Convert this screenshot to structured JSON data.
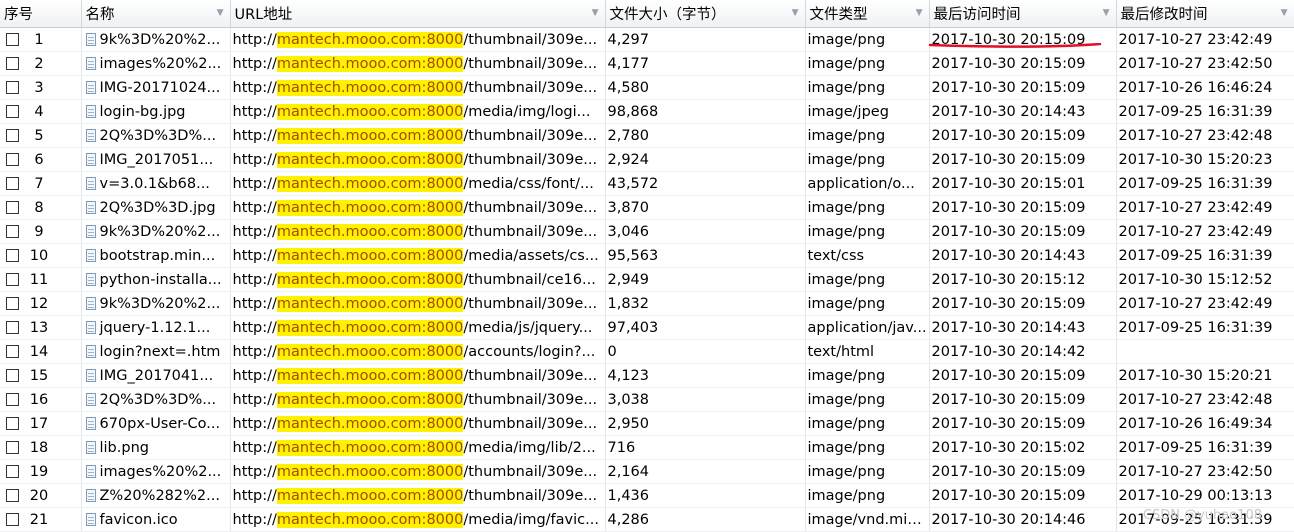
{
  "columns": [
    "序号",
    "名称",
    "URL地址",
    "文件大小（字节）",
    "文件类型",
    "最后访问时间",
    "最后修改时间"
  ],
  "host_highlight": "mantech.mooo.com:8000",
  "url_prefix": "http://",
  "rows": [
    {
      "no": "1",
      "name": "9k%3D%20%2...",
      "path": "/thumbnail/309e...",
      "size": "4,297",
      "type": "image/png",
      "accessed": "2017-10-30 20:15:09",
      "modified": "2017-10-27 23:42:49"
    },
    {
      "no": "2",
      "name": "images%20%2...",
      "path": "/thumbnail/309e...",
      "size": "4,177",
      "type": "image/png",
      "accessed": "2017-10-30 20:15:09",
      "modified": "2017-10-27 23:42:50"
    },
    {
      "no": "3",
      "name": "IMG-20171024...",
      "path": "/thumbnail/309e...",
      "size": "4,580",
      "type": "image/png",
      "accessed": "2017-10-30 20:15:09",
      "modified": "2017-10-26 16:46:24"
    },
    {
      "no": "4",
      "name": "login-bg.jpg",
      "path": "/media/img/logi...",
      "size": "98,868",
      "type": "image/jpeg",
      "accessed": "2017-10-30 20:14:43",
      "modified": "2017-09-25 16:31:39"
    },
    {
      "no": "5",
      "name": "2Q%3D%3D%...",
      "path": "/thumbnail/309e...",
      "size": "2,780",
      "type": "image/png",
      "accessed": "2017-10-30 20:15:09",
      "modified": "2017-10-27 23:42:48"
    },
    {
      "no": "6",
      "name": "IMG_2017051...",
      "path": "/thumbnail/309e...",
      "size": "2,924",
      "type": "image/png",
      "accessed": "2017-10-30 20:15:09",
      "modified": "2017-10-30 15:20:23"
    },
    {
      "no": "7",
      "name": "v=3.0.1&b68...",
      "path": "/media/css/font/...",
      "size": "43,572",
      "type": "application/o...",
      "accessed": "2017-10-30 20:15:01",
      "modified": "2017-09-25 16:31:39"
    },
    {
      "no": "8",
      "name": "2Q%3D%3D.jpg",
      "path": "/thumbnail/309e...",
      "size": "3,870",
      "type": "image/png",
      "accessed": "2017-10-30 20:15:09",
      "modified": "2017-10-27 23:42:49"
    },
    {
      "no": "9",
      "name": "9k%3D%20%2...",
      "path": "/thumbnail/309e...",
      "size": "3,046",
      "type": "image/png",
      "accessed": "2017-10-30 20:15:09",
      "modified": "2017-10-27 23:42:49"
    },
    {
      "no": "10",
      "name": "bootstrap.min...",
      "path": "/media/assets/cs...",
      "size": "95,563",
      "type": "text/css",
      "accessed": "2017-10-30 20:14:43",
      "modified": "2017-09-25 16:31:39"
    },
    {
      "no": "11",
      "name": "python-installa...",
      "path": "/thumbnail/ce16...",
      "size": "2,949",
      "type": "image/png",
      "accessed": "2017-10-30 20:15:12",
      "modified": "2017-10-30 15:12:52"
    },
    {
      "no": "12",
      "name": "9k%3D%20%2...",
      "path": "/thumbnail/309e...",
      "size": "1,832",
      "type": "image/png",
      "accessed": "2017-10-30 20:15:09",
      "modified": "2017-10-27 23:42:49"
    },
    {
      "no": "13",
      "name": "jquery-1.12.1...",
      "path": "/media/js/jquery...",
      "size": "97,403",
      "type": "application/jav...",
      "accessed": "2017-10-30 20:14:43",
      "modified": "2017-09-25 16:31:39"
    },
    {
      "no": "14",
      "name": "login?next=.htm",
      "path": "/accounts/login?...",
      "size": "0",
      "type": "text/html",
      "accessed": "2017-10-30 20:14:42",
      "modified": ""
    },
    {
      "no": "15",
      "name": "IMG_2017041...",
      "path": "/thumbnail/309e...",
      "size": "4,123",
      "type": "image/png",
      "accessed": "2017-10-30 20:15:09",
      "modified": "2017-10-30 15:20:21"
    },
    {
      "no": "16",
      "name": "2Q%3D%3D%...",
      "path": "/thumbnail/309e...",
      "size": "3,038",
      "type": "image/png",
      "accessed": "2017-10-30 20:15:09",
      "modified": "2017-10-27 23:42:48"
    },
    {
      "no": "17",
      "name": "670px-User-Co...",
      "path": "/thumbnail/309e...",
      "size": "2,950",
      "type": "image/png",
      "accessed": "2017-10-30 20:15:09",
      "modified": "2017-10-26 16:49:34"
    },
    {
      "no": "18",
      "name": "lib.png",
      "path": "/media/img/lib/2...",
      "size": "716",
      "type": "image/png",
      "accessed": "2017-10-30 20:15:02",
      "modified": "2017-09-25 16:31:39"
    },
    {
      "no": "19",
      "name": "images%20%2...",
      "path": "/thumbnail/309e...",
      "size": "2,164",
      "type": "image/png",
      "accessed": "2017-10-30 20:15:09",
      "modified": "2017-10-27 23:42:50"
    },
    {
      "no": "20",
      "name": "Z%20%282%2...",
      "path": "/thumbnail/309e...",
      "size": "1,436",
      "type": "image/png",
      "accessed": "2017-10-30 20:15:09",
      "modified": "2017-10-29 00:13:13"
    },
    {
      "no": "21",
      "name": "favicon.ico",
      "path": "/media/img/favic...",
      "size": "4,286",
      "type": "image/vnd.mic...",
      "accessed": "2017-10-30 20:14:46",
      "modified": "2017-09-25 16:31:39"
    }
  ],
  "watermark": "CSDN @yuhao108",
  "colors": {
    "highlight_bg": "#fff200",
    "highlight_text": "#a84a00",
    "annotation_stroke": "#e0102a"
  }
}
